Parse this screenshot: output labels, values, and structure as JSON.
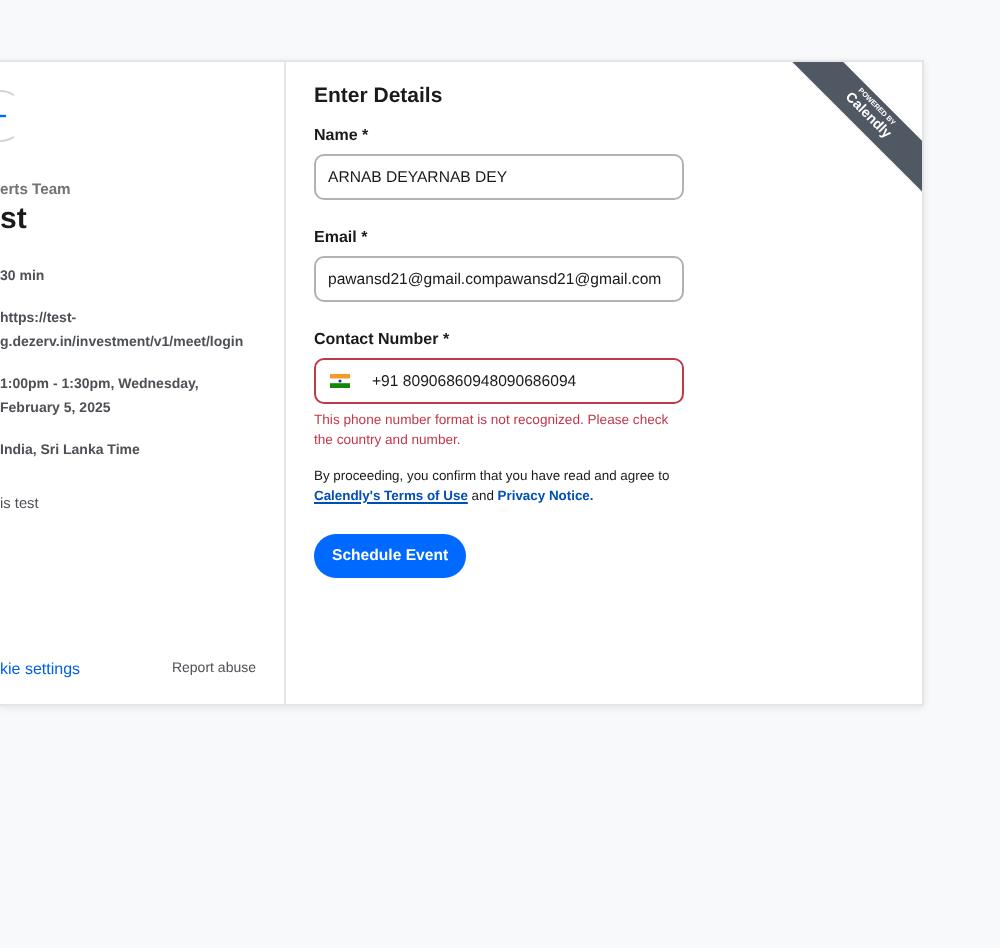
{
  "event_panel": {
    "back_button": {
      "kind": "back"
    },
    "organizer": "erts Team",
    "event_name": "st",
    "details": [
      [
        "30 min"
      ],
      [
        "https://test-",
        "g.dezerv.in/investment/v1/meet/login"
      ],
      [
        "1:00pm - 1:30pm, Wednesday,",
        "February 5, 2025"
      ],
      [
        "India, Sri Lanka Time"
      ]
    ],
    "description": "is test",
    "footer_links": [
      "kie settings",
      "Report abuse"
    ]
  },
  "form": {
    "title": "Enter Details",
    "fields": [
      {
        "label": "Name *",
        "value": "ARNAB DEYARNAB DEY",
        "kind": "text",
        "invalid": false
      },
      {
        "label": "Email *",
        "value": "pawansd21@gmail.compawansd21@gmail.com",
        "kind": "text",
        "invalid": false
      },
      {
        "label": "Contact Number *",
        "value": "+91 80906860948090686094",
        "kind": "phone",
        "invalid": true,
        "error": "This phone number format is not recognized. Please check the country and number."
      }
    ],
    "consent": "By proceeding, you confirm that you have read and agree to",
    "terms_link": "Calendly's Terms of Use",
    "and_text": "and",
    "privacy_link": "Privacy Notice.",
    "submit": "Schedule Event"
  },
  "ribbon": {
    "top": "POWERED BY",
    "brand": "Calendly"
  }
}
